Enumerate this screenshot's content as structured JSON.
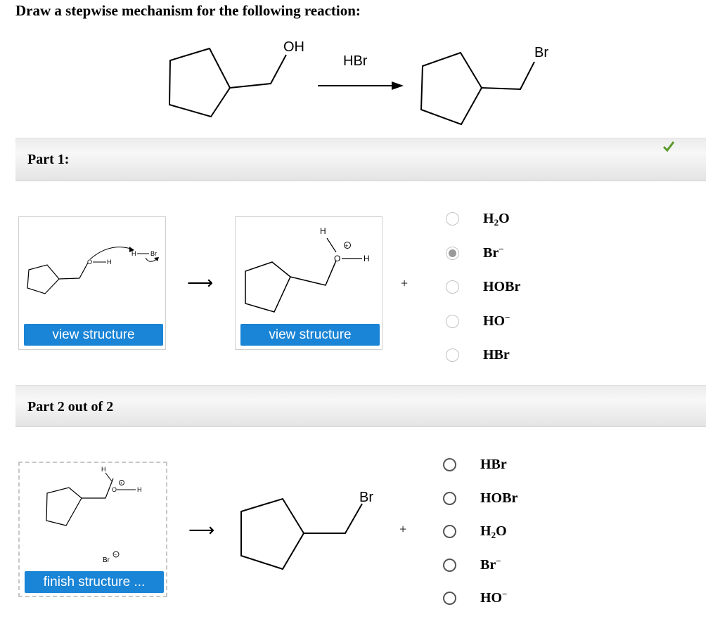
{
  "question": "Draw a stepwise mechanism for the following reaction:",
  "reaction": {
    "reactant_group": "OH",
    "reagent": "HBr",
    "product_group": "Br"
  },
  "part1": {
    "title": "Part 1:",
    "status": "correct",
    "left_box": {
      "labels": {
        "o": "O",
        "h1": "H",
        "h2": "H",
        "br": "Br"
      },
      "button": "view structure"
    },
    "right_box": {
      "labels": {
        "h_top": "H",
        "o": "O",
        "h_right": "H",
        "charge": "+"
      },
      "button": "view structure"
    },
    "plus": "+",
    "options": [
      {
        "base": "H",
        "sub": "2",
        "rest": "O",
        "sup": "",
        "selected": false
      },
      {
        "base": "Br",
        "sub": "",
        "rest": "",
        "sup": "−",
        "selected": true
      },
      {
        "base": "HOBr",
        "sub": "",
        "rest": "",
        "sup": "",
        "selected": false
      },
      {
        "base": "HO",
        "sub": "",
        "rest": "",
        "sup": "−",
        "selected": false
      },
      {
        "base": "HBr",
        "sub": "",
        "rest": "",
        "sup": "",
        "selected": false
      }
    ]
  },
  "part2": {
    "title": "Part 2 out of 2",
    "left_box": {
      "labels": {
        "h_top": "H",
        "o": "O",
        "h_right": "H",
        "charge": "+",
        "br": "Br",
        "br_charge": "−"
      },
      "button": "finish structure ..."
    },
    "product_group": "Br",
    "plus": "+",
    "options": [
      {
        "base": "HBr",
        "sub": "",
        "rest": "",
        "sup": "",
        "selected": false
      },
      {
        "base": "HOBr",
        "sub": "",
        "rest": "",
        "sup": "",
        "selected": false
      },
      {
        "base": "H",
        "sub": "2",
        "rest": "O",
        "sup": "",
        "selected": false
      },
      {
        "base": "Br",
        "sub": "",
        "rest": "",
        "sup": "−",
        "selected": false
      },
      {
        "base": "HO",
        "sub": "",
        "rest": "",
        "sup": "−",
        "selected": false
      }
    ]
  },
  "colors": {
    "button": "#1a84d6",
    "check": "#5a9a2a",
    "bar": "#ececec"
  },
  "icons": {
    "check": "check-icon",
    "arrow": "reaction-arrow-icon"
  }
}
